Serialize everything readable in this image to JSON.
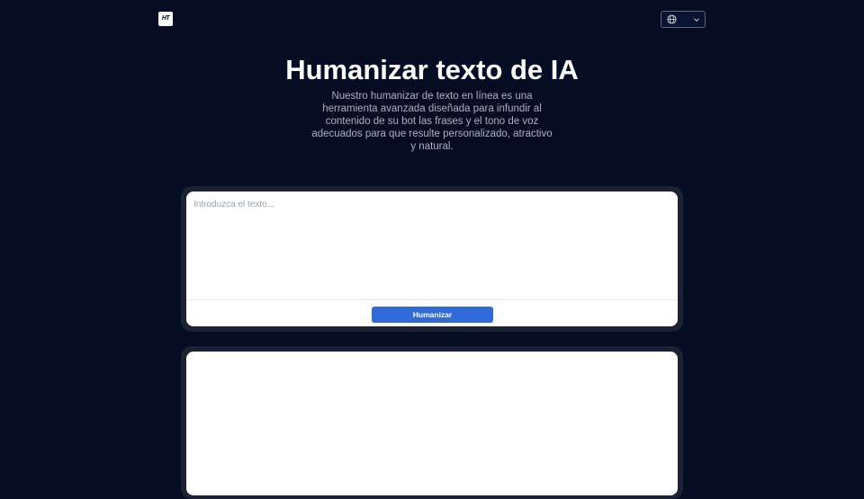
{
  "header": {
    "logo_text": "HT",
    "language_selector": {
      "icon": "globe-icon",
      "dropdown_icon": "chevron-down-icon"
    }
  },
  "hero": {
    "title": "Humanizar texto de IA",
    "subtitle": "Nuestro humanizar de texto en línea es una herramienta avanzada diseñada para infundir al contenido de su bot las frases y el tono de voz adecuados para que resulte personalizado, atractivo y natural."
  },
  "input_panel": {
    "value": "",
    "placeholder": "Introduzca el texto...",
    "button_label": "Humanizar"
  },
  "output_panel": {
    "value": ""
  },
  "colors": {
    "background": "#050d24",
    "panel": "#1c2233",
    "accent": "#3169d6"
  }
}
